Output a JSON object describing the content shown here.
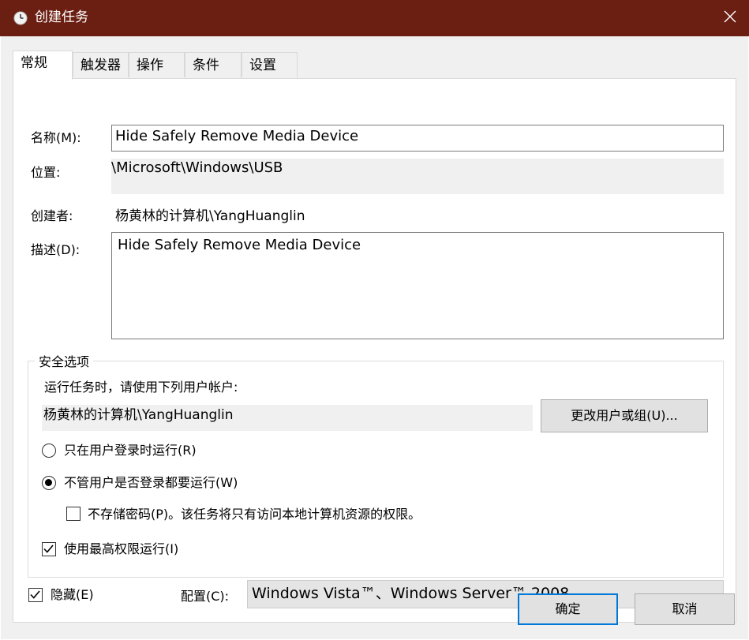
{
  "window": {
    "title": "创建任务",
    "close_glyph": "✕"
  },
  "tabs": [
    {
      "label": "常规",
      "active": true
    },
    {
      "label": "触发器"
    },
    {
      "label": "操作"
    },
    {
      "label": "条件"
    },
    {
      "label": "设置"
    }
  ],
  "general": {
    "name_label": "名称(M):",
    "name_value": "Hide Safely Remove Media Device",
    "location_label": "位置:",
    "location_value": "\\Microsoft\\Windows\\USB",
    "author_label": "创建者:",
    "author_value": "杨黄林的计算机\\YangHuanglin",
    "description_label": "描述(D):",
    "description_value": "Hide Safely Remove Media Device"
  },
  "security": {
    "group_title": "安全选项",
    "run_as_prompt": "运行任务时，请使用下列用户帐户:",
    "user_account": "杨黄林的计算机\\YangHuanglin",
    "change_user_button": "更改用户或组(U)...",
    "radio_logged_on": "只在用户登录时运行(R)",
    "radio_always": "不管用户是否登录都要运行(W)",
    "radio_always_selected": true,
    "checkbox_no_password": "不存储密码(P)。该任务将只有访问本地计算机资源的权限。",
    "checkbox_no_password_checked": false,
    "checkbox_highest": "使用最高权限运行(I)",
    "checkbox_highest_checked": true
  },
  "bottom": {
    "hidden_label": "隐藏(E)",
    "hidden_checked": true,
    "config_label": "配置(C):",
    "config_value": "Windows Vista™、Windows Server™ 2008"
  },
  "buttons": {
    "ok": "确定",
    "cancel": "取消"
  },
  "colors": {
    "titlebar": "#6b1f12",
    "accent": "#0078d7"
  }
}
